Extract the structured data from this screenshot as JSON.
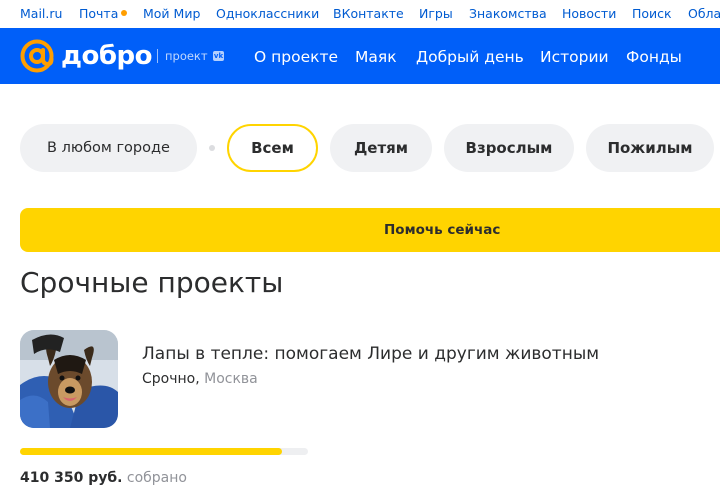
{
  "portal_bar": {
    "links": [
      "Mail.ru",
      "Почта",
      "Мой Мир",
      "Одноклассники",
      "ВКонтакте",
      "Игры",
      "Знакомства",
      "Новости",
      "Поиск",
      "Обла"
    ],
    "unread_dot_color": "#ff9e00"
  },
  "header": {
    "logo_text": "добро",
    "project_label": "проект",
    "vk_badge": "vk",
    "nav": [
      "О проекте",
      "Маяк",
      "Добрый день",
      "Истории",
      "Фонды"
    ],
    "background": "#005ff9"
  },
  "filters": {
    "city": "В любом городе",
    "audience": [
      "Всем",
      "Детям",
      "Взрослым",
      "Пожилым"
    ],
    "selected": "Всем"
  },
  "cta": {
    "label": "Помочь сейчас",
    "color": "#ffd400"
  },
  "section": {
    "title": "Срочные проекты"
  },
  "project": {
    "title": "Лапы в тепле: помогаем Лире и другим животным",
    "urgency": "Срочно,",
    "city": "Москва",
    "progress_fraction": 0.91,
    "raised_amount": "410 350 руб.",
    "raised_label": "собрано",
    "image": "dog-photo"
  }
}
